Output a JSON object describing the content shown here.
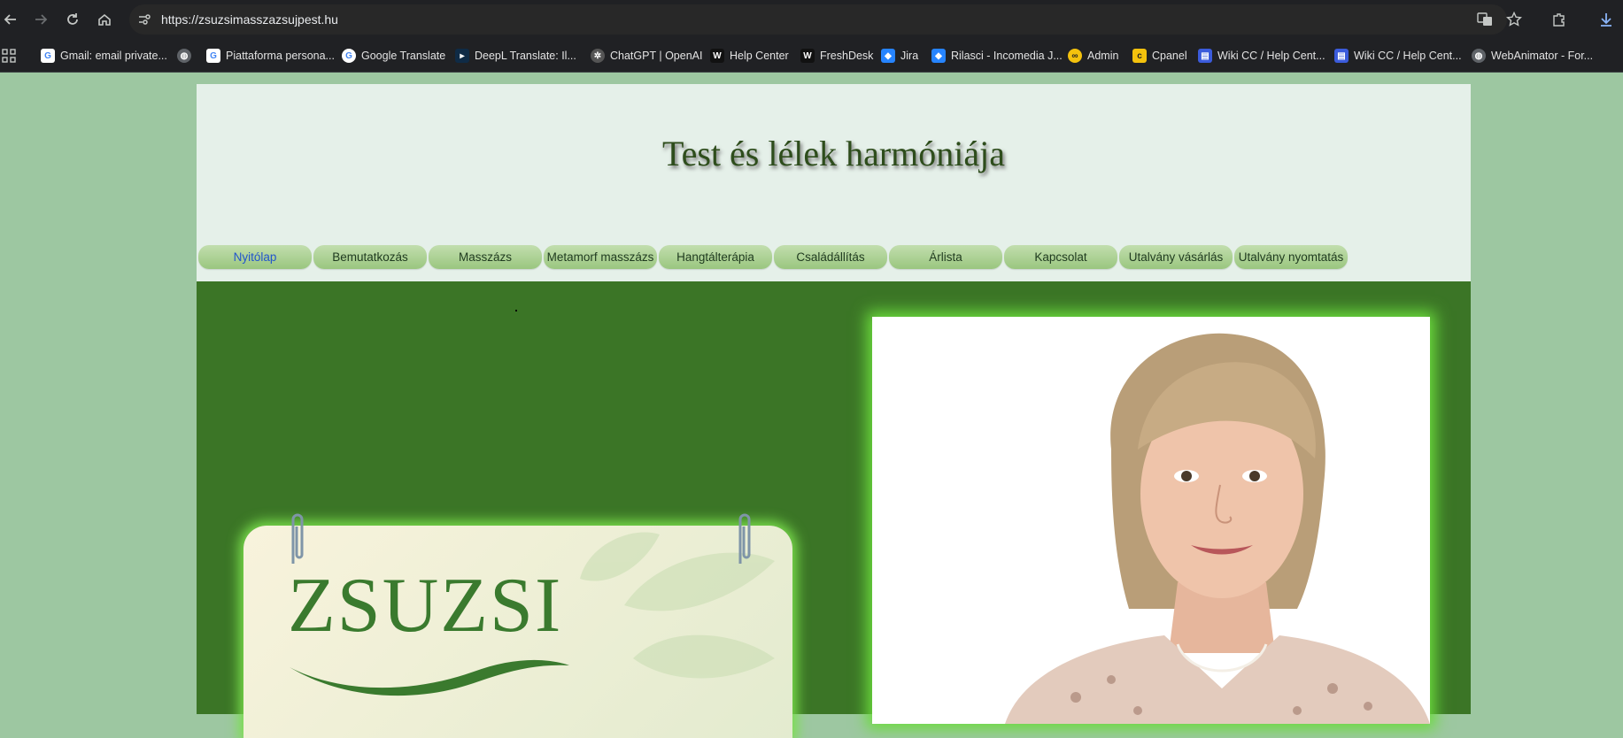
{
  "browser": {
    "url": "https://zsuzsimasszazsujpest.hu",
    "icons": [
      "back-arrow-icon",
      "forward-arrow-icon",
      "reload-icon",
      "home-icon",
      "site-settings-icon",
      "translate-icon",
      "star-icon",
      "extensions-icon",
      "download-icon",
      "apps-grid-icon"
    ],
    "bookmarks": [
      {
        "label": "Gmail: email private...",
        "icon": "google-icon",
        "color": "#4285f4"
      },
      {
        "label": "",
        "icon": "globe-icon",
        "color": "#9aa0a6"
      },
      {
        "label": "Piattaforma persona...",
        "icon": "google-icon",
        "color": "#4285f4"
      },
      {
        "label": "Google Translate",
        "icon": "google-icon",
        "color": "#4285f4"
      },
      {
        "label": "DeepL Translate: Il...",
        "icon": "deepl-icon",
        "color": "#0f2b46"
      },
      {
        "label": "ChatGPT | OpenAI",
        "icon": "openai-icon",
        "color": "#555555"
      },
      {
        "label": "Help Center",
        "icon": "ws-icon",
        "color": "#111111"
      },
      {
        "label": "FreshDesk",
        "icon": "ws-icon",
        "color": "#111111"
      },
      {
        "label": "Jira",
        "icon": "jira-icon",
        "color": "#2684ff"
      },
      {
        "label": "Rilasci - Incomedia J...",
        "icon": "jira-icon",
        "color": "#2684ff"
      },
      {
        "label": "Admin",
        "icon": "admin-icon",
        "color": "#f4c20d"
      },
      {
        "label": "Cpanel",
        "icon": "cpanel-icon",
        "color": "#f4c20d"
      },
      {
        "label": "Wiki CC / Help Cent...",
        "icon": "wiki-icon",
        "color": "#3b5bdb"
      },
      {
        "label": "Wiki CC / Help Cent...",
        "icon": "wiki-icon",
        "color": "#3b5bdb"
      },
      {
        "label": "WebAnimator - For...",
        "icon": "globe-icon",
        "color": "#9aa0a6"
      }
    ]
  },
  "site": {
    "title": "Test és lélek harmóniája",
    "menu": [
      {
        "label": "Nyitólap",
        "active": true
      },
      {
        "label": "Bemutatkozás"
      },
      {
        "label": "Masszázs"
      },
      {
        "label": "Metamorf masszázs"
      },
      {
        "label": "Hangtálterápia"
      },
      {
        "label": "Családállítás"
      },
      {
        "label": "Árlista"
      },
      {
        "label": "Kapcsolat"
      },
      {
        "label": "Utalvány vásárlás"
      },
      {
        "label": "Utalvány nyomtatás"
      }
    ],
    "card_word": "ZSUZSI",
    "colors": {
      "page_bg": "#9dc7a1",
      "header_bg": "#e5f0e9",
      "content_bg": "#3b7526",
      "glow": "#6bdc3d",
      "menu_active": "#2255cc"
    }
  }
}
